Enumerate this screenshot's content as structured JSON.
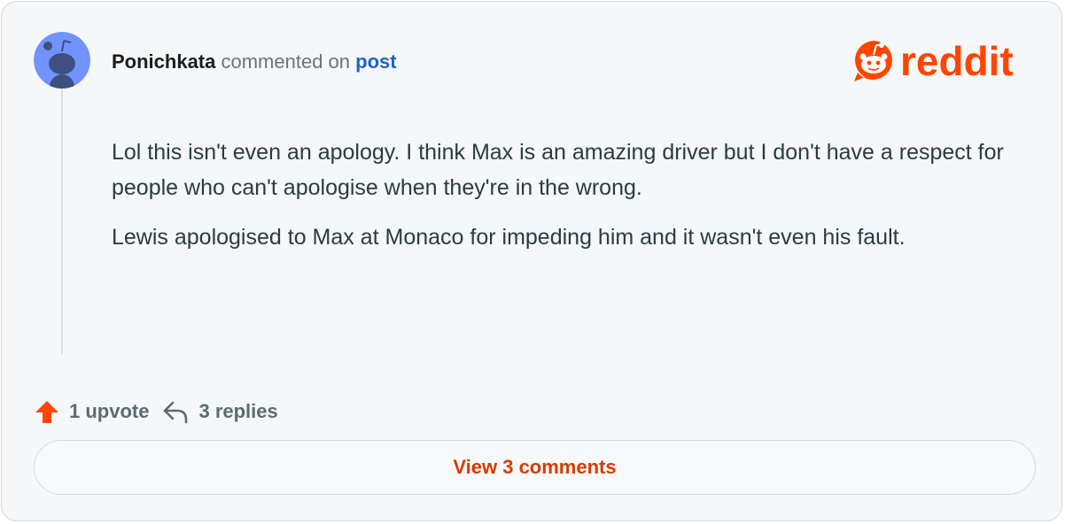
{
  "comment": {
    "username": "Ponichkata",
    "action_text": "commented on",
    "post_link": "post",
    "paragraphs": [
      "Lol this isn't even an apology. I think Max is an amazing driver but I don't have a respect for people who can't apologise when they're in the wrong.",
      "Lewis apologised to Max at Monaco for impeding him and it wasn't even his fault."
    ]
  },
  "logo": {
    "text": "reddit",
    "color": "#ff4500"
  },
  "actions": {
    "upvotes": "1 upvote",
    "replies": "3 replies"
  },
  "view_button": {
    "label": "View 3 comments"
  },
  "colors": {
    "accent": "#ff4500",
    "link": "#1a63c8",
    "view_button_text": "#d93a00",
    "avatar_bg": "#7193ff"
  }
}
